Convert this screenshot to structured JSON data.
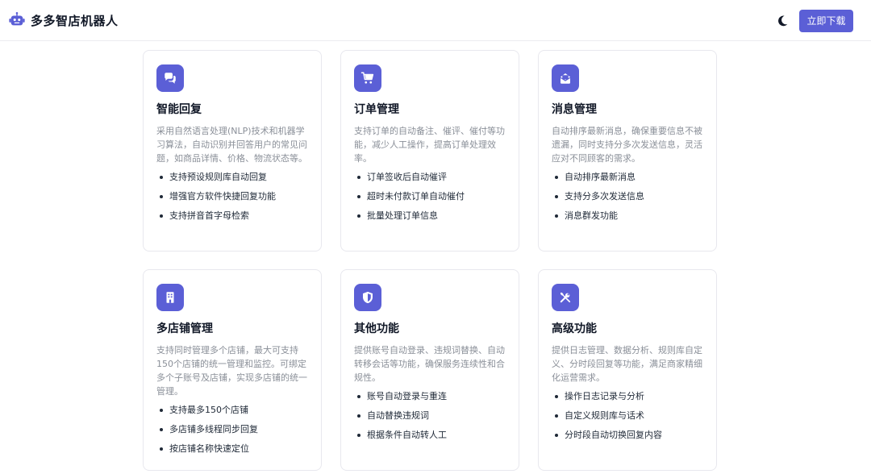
{
  "header": {
    "title": "多多智店机器人",
    "logo_icon": "robot-icon",
    "theme_icon": "moon-icon",
    "download_label": "立即下载"
  },
  "colors": {
    "accent": "#5b5fd6",
    "muted_text": "#8a8f98",
    "border": "#e8e8ee"
  },
  "cards": [
    {
      "icon": "chat-bubbles-icon",
      "title": "智能回复",
      "desc": "采用自然语言处理(NLP)技术和机器学习算法，自动识别并回答用户的常见问题，如商品详情、价格、物流状态等。",
      "items": [
        "支持预设规则库自动回复",
        "增强官方软件快捷回复功能",
        "支持拼音首字母检索"
      ]
    },
    {
      "icon": "shopping-cart-icon",
      "title": "订单管理",
      "desc": "支持订单的自动备注、催评、催付等功能，减少人工操作，提高订单处理效率。",
      "items": [
        "订单签收后自动催评",
        "超时未付款订单自动催付",
        "批量处理订单信息"
      ]
    },
    {
      "icon": "envelope-icon",
      "title": "消息管理",
      "desc": "自动排序最新消息，确保重要信息不被遗漏，同时支持分多次发送信息，灵活应对不同顾客的需求。",
      "items": [
        "自动排序最新消息",
        "支持分多次发送信息",
        "消息群发功能"
      ]
    },
    {
      "icon": "building-icon",
      "title": "多店铺管理",
      "desc": "支持同时管理多个店铺，最大可支持150个店铺的统一管理和监控。可绑定多个子账号及店铺，实现多店铺的统一管理。",
      "items": [
        "支持最多150个店铺",
        "多店铺多线程同步回复",
        "按店铺名称快速定位"
      ]
    },
    {
      "icon": "shield-icon",
      "title": "其他功能",
      "desc": "提供账号自动登录、违规词替换、自动转移会话等功能，确保服务连续性和合规性。",
      "items": [
        "账号自动登录与重连",
        "自动替换违规词",
        "根据条件自动转人工"
      ]
    },
    {
      "icon": "tools-icon",
      "title": "高级功能",
      "desc": "提供日志管理、数据分析、规则库自定义、分时段回复等功能，满足商家精细化运营需求。",
      "items": [
        "操作日志记录与分析",
        "自定义规则库与话术",
        "分时段自动切换回复内容"
      ]
    }
  ]
}
